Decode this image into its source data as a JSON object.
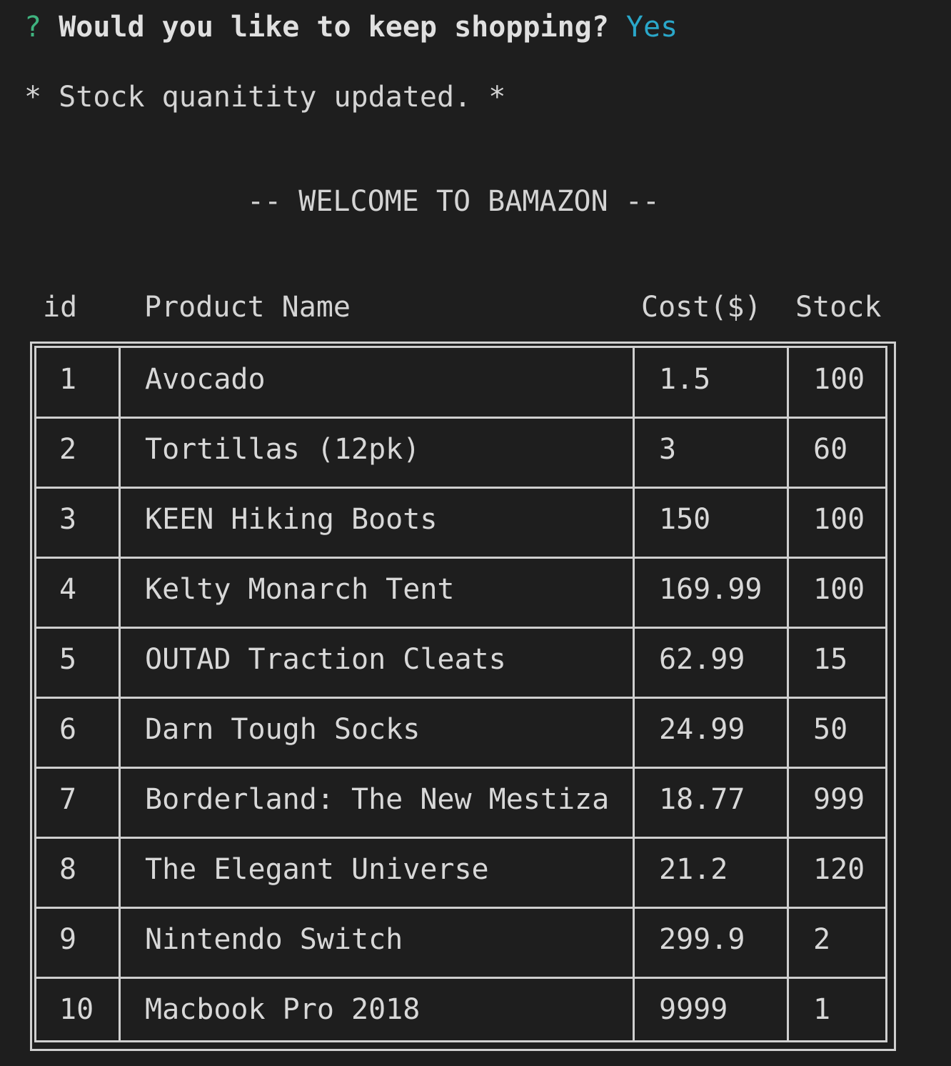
{
  "prompt": {
    "mark": "?",
    "question": "Would you like to keep shopping?",
    "answer": "Yes"
  },
  "status_message": "* Stock quanitity updated. *",
  "banner": "-- WELCOME TO BAMAZON --",
  "table": {
    "columns": [
      "id",
      "Product Name",
      "Cost($)",
      "Stock"
    ],
    "rows": [
      {
        "id": "1",
        "name": "Avocado",
        "cost": "1.5",
        "stock": "100"
      },
      {
        "id": "2",
        "name": "Tortillas (12pk)",
        "cost": "3",
        "stock": "60"
      },
      {
        "id": "3",
        "name": "KEEN Hiking Boots",
        "cost": "150",
        "stock": "100"
      },
      {
        "id": "4",
        "name": "Kelty Monarch Tent",
        "cost": "169.99",
        "stock": "100"
      },
      {
        "id": "5",
        "name": "OUTAD Traction Cleats",
        "cost": "62.99",
        "stock": "15"
      },
      {
        "id": "6",
        "name": "Darn Tough Socks",
        "cost": "24.99",
        "stock": "50"
      },
      {
        "id": "7",
        "name": "Borderland: The New Mestiza",
        "cost": "18.77",
        "stock": "999"
      },
      {
        "id": "8",
        "name": "The Elegant Universe",
        "cost": "21.2",
        "stock": "120"
      },
      {
        "id": "9",
        "name": "Nintendo Switch",
        "cost": "299.9",
        "stock": "2"
      },
      {
        "id": "10",
        "name": "Macbook Pro 2018",
        "cost": "9999",
        "stock": "1"
      }
    ]
  }
}
